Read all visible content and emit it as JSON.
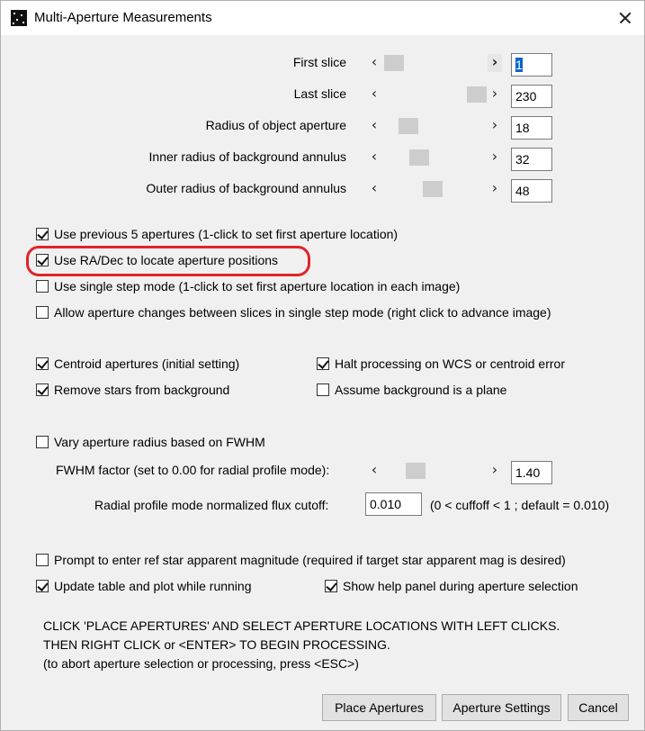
{
  "window": {
    "title": "Multi-Aperture Measurements"
  },
  "sliders": [
    {
      "label": "First slice",
      "value": "1",
      "selected": true
    },
    {
      "label": "Last slice",
      "value": "230"
    },
    {
      "label": "Radius of object aperture",
      "value": "18"
    },
    {
      "label": "Inner radius of background annulus",
      "value": "32"
    },
    {
      "label": "Outer radius of background annulus",
      "value": "48"
    }
  ],
  "arrows": {
    "left": "‹",
    "right": "›"
  },
  "options": {
    "use_previous": {
      "label": "Use previous 5 apertures (1-click to set first aperture location)",
      "checked": true
    },
    "use_radec": {
      "label": "Use RA/Dec to locate aperture positions",
      "checked": true
    },
    "single_step": {
      "label": "Use single step mode (1-click to set first aperture location in each image)",
      "checked": false
    },
    "allow_changes": {
      "label": "Allow aperture changes between slices in single step mode (right click to advance image)",
      "checked": false
    },
    "centroid": {
      "label": "Centroid apertures (initial setting)",
      "checked": true
    },
    "halt": {
      "label": "Halt processing on WCS or centroid error",
      "checked": true
    },
    "remove_stars": {
      "label": "Remove stars from background",
      "checked": true
    },
    "assume_plane": {
      "label": "Assume background is a plane",
      "checked": false
    },
    "vary_radius": {
      "label": "Vary aperture radius based on FWHM",
      "checked": false
    },
    "prompt_mag": {
      "label": "Prompt to enter ref star apparent magnitude (required if target star apparent mag is desired)",
      "checked": false
    },
    "update_table": {
      "label": "Update table and plot while running",
      "checked": true
    },
    "show_help": {
      "label": "Show help panel during aperture selection",
      "checked": true
    }
  },
  "fwhm": {
    "label": "FWHM factor (set to 0.00 for radial profile mode):",
    "value": "1.40"
  },
  "radial": {
    "label": "Radial profile mode normalized flux cutoff:",
    "value": "0.010",
    "hint": "(0 < cuffoff < 1 ; default = 0.010)"
  },
  "instructions": [
    "CLICK 'PLACE APERTURES' AND SELECT APERTURE LOCATIONS WITH LEFT CLICKS.",
    "THEN RIGHT CLICK or <ENTER> TO BEGIN PROCESSING.",
    "(to abort aperture selection or processing, press <ESC>)"
  ],
  "buttons": {
    "place": "Place Apertures",
    "settings": "Aperture Settings",
    "cancel": "Cancel"
  }
}
